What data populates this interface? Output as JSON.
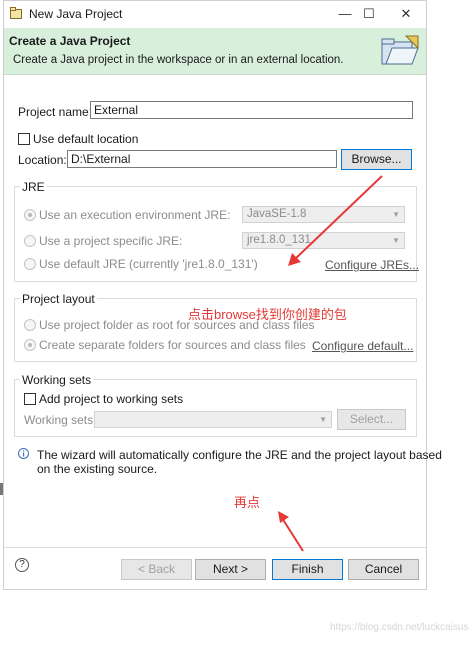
{
  "window": {
    "title": "New Java Project",
    "controls": [
      "—",
      "☐",
      "✕"
    ]
  },
  "banner": {
    "heading": "Create a Java Project",
    "description": "Create a Java project in the workspace or in an external location."
  },
  "project": {
    "name_label": "Project name:",
    "name_value": "External",
    "use_default_location_label": "Use default location",
    "location_label": "Location:",
    "location_value": "D:\\External",
    "browse_label": "Browse..."
  },
  "jre": {
    "title": "JRE",
    "option_env": "Use an execution environment JRE:",
    "env_value": "JavaSE-1.8",
    "option_specific": "Use a project specific JRE:",
    "specific_value": "jre1.8.0_131",
    "option_default": "Use default JRE (currently 'jre1.8.0_131')",
    "configure_link": "Configure JREs..."
  },
  "layout": {
    "title": "Project layout",
    "option_root": "Use project folder as root for sources and class files",
    "option_separate": "Create separate folders for sources and class files",
    "configure_link": "Configure default..."
  },
  "working_sets": {
    "title": "Working sets",
    "add_label": "Add project to working sets",
    "label": "Working sets:",
    "select_label": "Select..."
  },
  "info": {
    "line1": "The wizard will automatically configure the JRE and the project layout based",
    "line2": "on the existing source."
  },
  "annotations": {
    "note1": "点击browse找到你创建的包",
    "note2": "再点"
  },
  "footer": {
    "help_label": "?",
    "back_label": "< Back",
    "next_label": "Next >",
    "finish_label": "Finish",
    "cancel_label": "Cancel"
  },
  "watermark": "https://blog.csdn.net/luckcaisus",
  "colors": {
    "banner_bg": "#d8efdc",
    "annotation": "#e53935",
    "focus_border": "#0078d7"
  }
}
